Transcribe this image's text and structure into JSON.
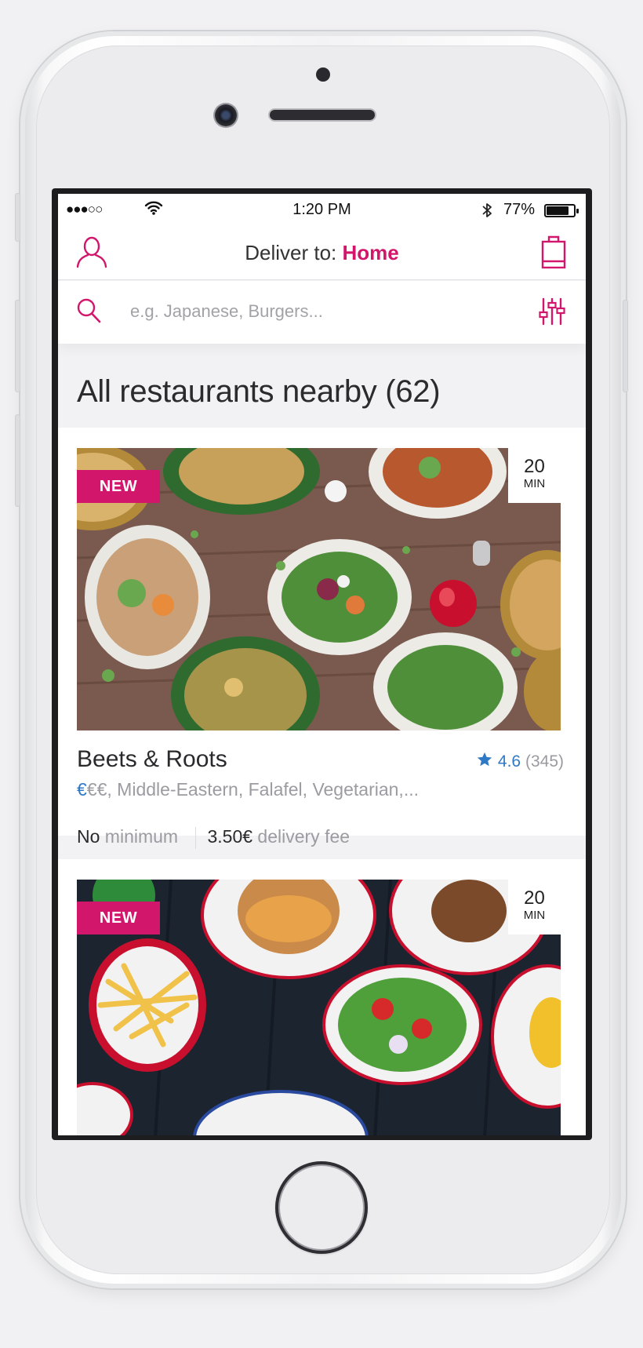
{
  "status_bar": {
    "signal": "●●●○○",
    "time": "1:20 PM",
    "battery_pct": "77%",
    "battery_level": 0.77
  },
  "header": {
    "deliver_label": "Deliver to:",
    "deliver_location": "Home",
    "user_icon": "user-icon",
    "bag_icon": "shopping-bag-icon"
  },
  "search": {
    "placeholder": "e.g. Japanese, Burgers...",
    "value": "",
    "filter_icon": "filter-sliders-icon"
  },
  "section_title": "All restaurants nearby (62)",
  "restaurants": [
    {
      "badge": "NEW",
      "eta_num": "20",
      "eta_unit": "MIN",
      "name": "Beets & Roots",
      "rating": "4.6",
      "reviews": "(345)",
      "price_active": "€",
      "price_inactive": "€€",
      "cuisines": ", Middle-Eastern, Falafel, Vegetarian,...",
      "minimum_value": "No",
      "minimum_label": "minimum",
      "fee_value": "3.50€",
      "fee_label": "delivery fee"
    },
    {
      "badge": "NEW",
      "eta_num": "20",
      "eta_unit": "MIN"
    }
  ],
  "colors": {
    "brand": "#d1166b",
    "rating_blue": "#2f79c6"
  }
}
